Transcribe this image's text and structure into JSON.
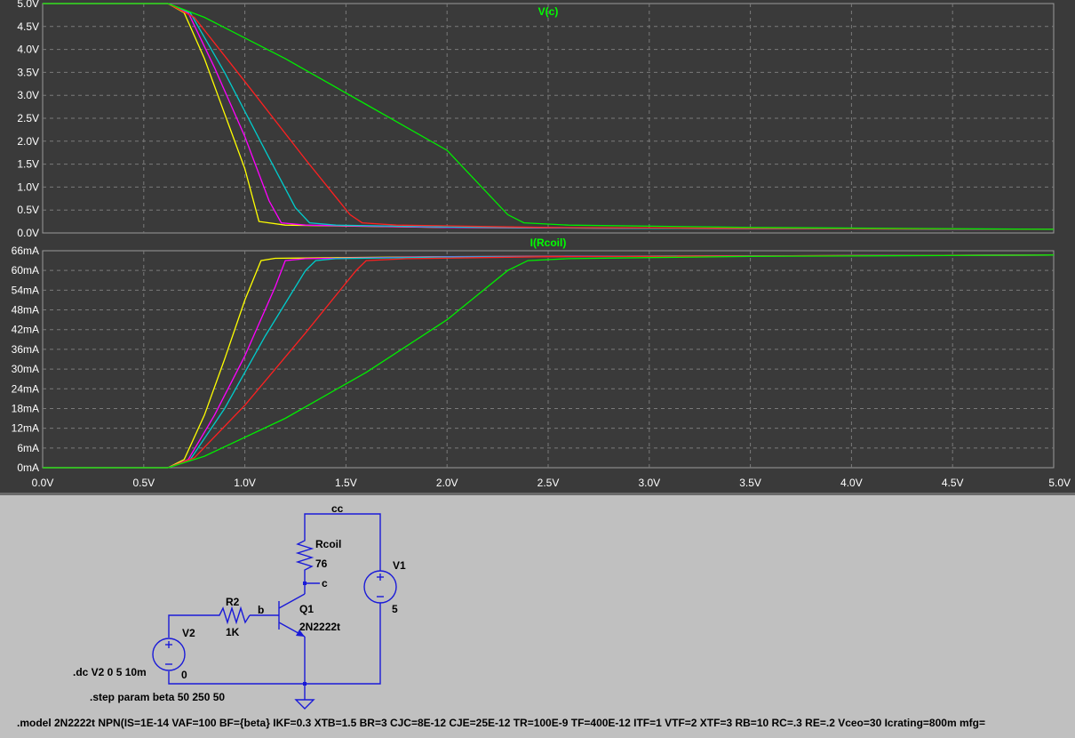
{
  "waveform": {
    "x_ticks": [
      "0.0V",
      "0.5V",
      "1.0V",
      "1.5V",
      "2.0V",
      "2.5V",
      "3.0V",
      "3.5V",
      "4.0V",
      "4.5V",
      "5.0V"
    ],
    "top_plot": {
      "title": "V(c)",
      "y_ticks": [
        "0.0V",
        "0.5V",
        "1.0V",
        "1.5V",
        "2.0V",
        "2.5V",
        "3.0V",
        "3.5V",
        "4.0V",
        "4.5V",
        "5.0V"
      ]
    },
    "bottom_plot": {
      "title": "I(Rcoil)",
      "y_ticks": [
        "0mA",
        "6mA",
        "12mA",
        "18mA",
        "24mA",
        "30mA",
        "36mA",
        "42mA",
        "48mA",
        "54mA",
        "60mA",
        "66mA"
      ]
    }
  },
  "chart_data": [
    {
      "type": "line",
      "title": "V(c)",
      "x_unit": "V",
      "y_unit": "V",
      "xlim": [
        0,
        5
      ],
      "ylim": [
        0,
        5
      ],
      "grid": true,
      "series": [
        {
          "color": "#ffff00",
          "points": [
            [
              0,
              5.0
            ],
            [
              0.62,
              5.0
            ],
            [
              0.7,
              4.8
            ],
            [
              0.8,
              3.8
            ],
            [
              0.9,
              2.6
            ],
            [
              1.0,
              1.4
            ],
            [
              1.07,
              0.25
            ],
            [
              1.2,
              0.17
            ],
            [
              2.0,
              0.12
            ],
            [
              3.0,
              0.1
            ],
            [
              5.0,
              0.08
            ]
          ]
        },
        {
          "color": "#ff00ff",
          "points": [
            [
              0,
              5.0
            ],
            [
              0.62,
              5.0
            ],
            [
              0.72,
              4.8
            ],
            [
              0.85,
              3.6
            ],
            [
              1.0,
              2.1
            ],
            [
              1.12,
              0.7
            ],
            [
              1.18,
              0.22
            ],
            [
              1.3,
              0.17
            ],
            [
              2.0,
              0.12
            ],
            [
              3.0,
              0.1
            ],
            [
              5.0,
              0.08
            ]
          ]
        },
        {
          "color": "#00cccc",
          "points": [
            [
              0,
              5.0
            ],
            [
              0.62,
              5.0
            ],
            [
              0.73,
              4.8
            ],
            [
              0.9,
              3.5
            ],
            [
              1.1,
              1.8
            ],
            [
              1.25,
              0.55
            ],
            [
              1.32,
              0.22
            ],
            [
              1.45,
              0.17
            ],
            [
              2.0,
              0.13
            ],
            [
              3.0,
              0.1
            ],
            [
              5.0,
              0.08
            ]
          ]
        },
        {
          "color": "#ff2020",
          "points": [
            [
              0,
              5.0
            ],
            [
              0.62,
              5.0
            ],
            [
              0.75,
              4.7
            ],
            [
              1.0,
              3.3
            ],
            [
              1.3,
              1.6
            ],
            [
              1.52,
              0.4
            ],
            [
              1.58,
              0.22
            ],
            [
              1.75,
              0.17
            ],
            [
              2.5,
              0.12
            ],
            [
              3.5,
              0.1
            ],
            [
              5.0,
              0.08
            ]
          ]
        },
        {
          "color": "#00ee00",
          "points": [
            [
              0,
              5.0
            ],
            [
              0.62,
              5.0
            ],
            [
              0.8,
              4.7
            ],
            [
              1.2,
              3.8
            ],
            [
              1.6,
              2.8
            ],
            [
              2.0,
              1.8
            ],
            [
              2.3,
              0.4
            ],
            [
              2.38,
              0.22
            ],
            [
              2.6,
              0.17
            ],
            [
              3.5,
              0.12
            ],
            [
              5.0,
              0.08
            ]
          ]
        }
      ]
    },
    {
      "type": "line",
      "title": "I(Rcoil)",
      "x_unit": "V",
      "y_unit": "mA",
      "xlim": [
        0,
        5
      ],
      "ylim": [
        0,
        66
      ],
      "grid": true,
      "series": [
        {
          "color": "#ffff00",
          "points": [
            [
              0,
              0
            ],
            [
              0.62,
              0
            ],
            [
              0.7,
              2.5
            ],
            [
              0.8,
              16
            ],
            [
              0.9,
              33
            ],
            [
              1.0,
              51
            ],
            [
              1.08,
              63
            ],
            [
              1.15,
              63.7
            ],
            [
              2.0,
              64.2
            ],
            [
              5.0,
              64.7
            ]
          ]
        },
        {
          "color": "#ff00ff",
          "points": [
            [
              0,
              0
            ],
            [
              0.62,
              0
            ],
            [
              0.72,
              2.5
            ],
            [
              0.85,
              16
            ],
            [
              1.0,
              34
            ],
            [
              1.15,
              55
            ],
            [
              1.2,
              63
            ],
            [
              1.3,
              63.6
            ],
            [
              2.0,
              64.2
            ],
            [
              5.0,
              64.7
            ]
          ]
        },
        {
          "color": "#00cccc",
          "points": [
            [
              0,
              0
            ],
            [
              0.62,
              0
            ],
            [
              0.73,
              2.5
            ],
            [
              0.9,
              18
            ],
            [
              1.1,
              40
            ],
            [
              1.3,
              60
            ],
            [
              1.35,
              63
            ],
            [
              1.45,
              63.6
            ],
            [
              2.0,
              64.1
            ],
            [
              5.0,
              64.7
            ]
          ]
        },
        {
          "color": "#ff2020",
          "points": [
            [
              0,
              0
            ],
            [
              0.62,
              0
            ],
            [
              0.75,
              3
            ],
            [
              1.0,
              19
            ],
            [
              1.3,
              41
            ],
            [
              1.55,
              60
            ],
            [
              1.6,
              63
            ],
            [
              1.8,
              63.6
            ],
            [
              2.5,
              64.2
            ],
            [
              5.0,
              64.7
            ]
          ]
        },
        {
          "color": "#00ee00",
          "points": [
            [
              0,
              0
            ],
            [
              0.62,
              0
            ],
            [
              0.8,
              3.5
            ],
            [
              1.2,
              15
            ],
            [
              1.6,
              29
            ],
            [
              2.0,
              45
            ],
            [
              2.3,
              60
            ],
            [
              2.4,
              63
            ],
            [
              2.6,
              63.6
            ],
            [
              3.5,
              64.3
            ],
            [
              5.0,
              64.7
            ]
          ]
        }
      ]
    }
  ],
  "schematic": {
    "net_cc": "cc",
    "net_c": "c",
    "net_b": "b",
    "rcoil_name": "Rcoil",
    "rcoil_value": "76",
    "v1_name": "V1",
    "v1_value": "5",
    "r2_name": "R2",
    "r2_value": "1K",
    "q1_name": "Q1",
    "q1_model": "2N2222t",
    "v2_name": "V2",
    "v2_value": "0",
    "dc_directive": ".dc V2 0 5 10m",
    "step_directive": ".step param beta 50 250 50",
    "model_directive": ".model 2N2222t NPN(IS=1E-14 VAF=100 BF={beta} IKF=0.3 XTB=1.5 BR=3 CJC=8E-12 CJE=25E-12 TR=100E-9 TF=400E-12 ITF=1 VTF=2 XTF=3 RB=10 RC=.3 RE=.2 Vceo=30 Icrating=800m mfg="
  }
}
